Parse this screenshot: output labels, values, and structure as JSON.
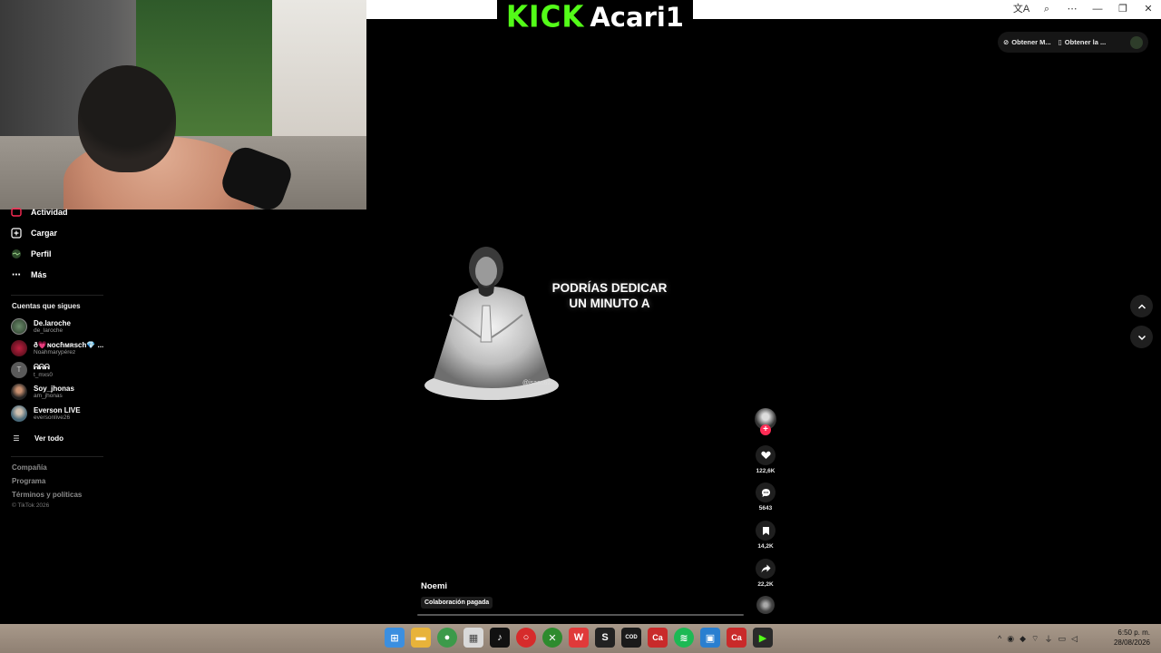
{
  "overlay": {
    "kick_word": "KICK",
    "streamer_name": "Acari1"
  },
  "window_controls": [
    "文A",
    "⌕",
    "⋯",
    "—",
    "❐",
    "✕"
  ],
  "top_pills": {
    "item1": "Obtener M...",
    "item2": "Obtener la ..."
  },
  "sidebar": {
    "nav": [
      {
        "label": "Actividad",
        "icon": "activity-icon"
      },
      {
        "label": "Cargar",
        "icon": "upload-icon"
      },
      {
        "label": "Perfil",
        "icon": "profile-icon"
      },
      {
        "label": "Más",
        "icon": "more-icon"
      }
    ],
    "following_title": "Cuentas que sigues",
    "following": [
      {
        "name": "De.laroche",
        "handle": "de_laroche"
      },
      {
        "name": "ð💗ɴᴏᴄɦᴍʀsᴄh💎 ...",
        "handle": "Noahmarypérez"
      },
      {
        "name": "ᕱᕱᕱ",
        "handle": "t_mxs0"
      },
      {
        "name": "Soy_jhonas",
        "handle": "am_jhonas"
      },
      {
        "name": "Everson LIVE",
        "handle": "eversonlive26"
      }
    ],
    "see_all": "Ver todo",
    "footer": [
      "Compañía",
      "Programa",
      "Términos y políticas"
    ],
    "copyright": "© TikTok 2026"
  },
  "video": {
    "caption": "PODRÍAS DEDICAR UN MINUTO A",
    "watermark": "@isaac622",
    "author": "Noemi",
    "paid_badge": "Colaboración pagada",
    "progress": 0.0
  },
  "actions": {
    "likes": "122,6K",
    "comments": "5643",
    "saves": "14,2K",
    "shares": "22,2K"
  },
  "taskbar": {
    "time": "6:50 p. m.",
    "date": "28/08/2026"
  },
  "colors": {
    "kick_green": "#53fc18",
    "tiktok_red": "#fe2c55"
  }
}
